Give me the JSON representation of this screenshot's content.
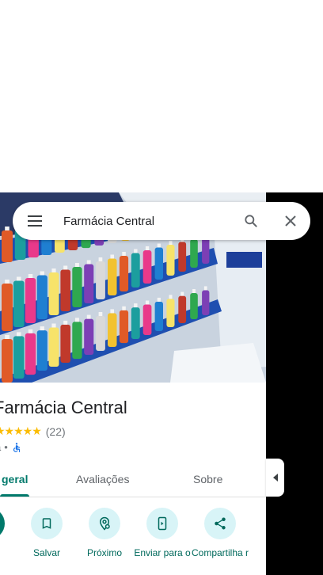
{
  "search": {
    "query": "Farmácia Central"
  },
  "place": {
    "title": "Farmácia Central",
    "stars": "★★★★★",
    "rating_count": "(22)",
    "category": "a",
    "separator": "•"
  },
  "tabs": [
    {
      "label": "geral",
      "active": true
    },
    {
      "label": "Avaliações",
      "active": false
    },
    {
      "label": "Sobre",
      "active": false
    }
  ],
  "actions": [
    {
      "label": "s",
      "icon": "directions-icon"
    },
    {
      "label": "Salvar",
      "icon": "bookmark-icon"
    },
    {
      "label": "Próximo",
      "icon": "nearby-icon"
    },
    {
      "label": "Enviar para o",
      "icon": "send-to-phone-icon"
    },
    {
      "label": "Compartilha r",
      "icon": "share-icon"
    }
  ],
  "colors": {
    "accent": "#00796b",
    "action_bg": "#d8f4f7",
    "star": "#fbbc04",
    "link": "#1a73e8"
  }
}
